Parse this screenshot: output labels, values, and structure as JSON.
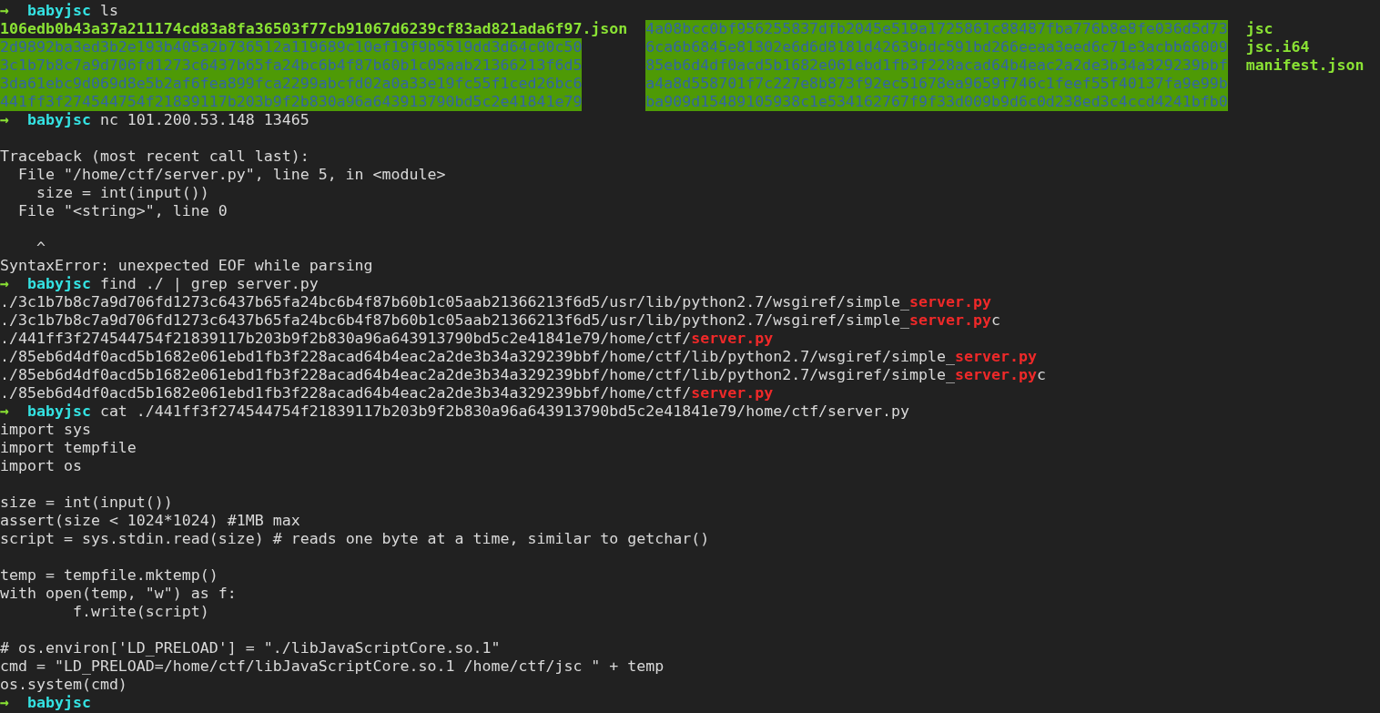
{
  "terminal": {
    "session": [
      {
        "prompt": {
          "arrow": "→",
          "directory": "babyjsc",
          "command": "ls"
        },
        "output": {
          "kind": "listing",
          "columns": [
            [
              {
                "name": "106edb0b43a37a211174cd83a8fa36503f77cb91067d6239cf83ad821ada6f97.json",
                "kind": "executable"
              },
              {
                "name": "2d9892ba3ed3b2e193b405a2b736512a119689c10ef19f9b5519dd3d64c00c50",
                "kind": "directory"
              },
              {
                "name": "3c1b7b8c7a9d706fd1273c6437b65fa24bc6b4f87b60b1c05aab21366213f6d5",
                "kind": "directory"
              },
              {
                "name": "3da61ebc9d069d8e5b2af6fea899fca2299abcfd02a0a33e19fc55f1ced26bc6",
                "kind": "directory"
              },
              {
                "name": "441ff3f274544754f21839117b203b9f2b830a96a643913790bd5c2e41841e79",
                "kind": "directory"
              }
            ],
            [
              {
                "name": "4a08bcc0bf956255837dfb2045e519a1725861c88487fba776b8e8fe036d5d73",
                "kind": "directory"
              },
              {
                "name": "6ca6b6845e81302e6d6d8181d42639bdc591bd266eeaa3eed6c71e3acbb66009",
                "kind": "directory"
              },
              {
                "name": "85eb6d4df0acd5b1682e061ebd1fb3f228acad64b4eac2a2de3b34a329239bbf",
                "kind": "directory"
              },
              {
                "name": "a4a8d558701f7c227e8b873f92ec51678ea9659f746c1feef55f40137fa9e99b",
                "kind": "directory"
              },
              {
                "name": "ba909d15489105938c1e534162767f9f33d009b9d6c0d238ed3c4ccd4241bfb0",
                "kind": "directory"
              }
            ],
            [
              {
                "name": "jsc",
                "kind": "executable"
              },
              {
                "name": "jsc.i64",
                "kind": "executable"
              },
              {
                "name": "manifest.json",
                "kind": "executable"
              }
            ]
          ]
        }
      },
      {
        "prompt": {
          "arrow": "→",
          "directory": "babyjsc",
          "command": "nc 101.200.53.148 13465"
        },
        "output": {
          "kind": "traceback",
          "lines": [
            {
              "kind": "blank"
            },
            {
              "kind": "text",
              "text": "Traceback (most recent call last):",
              "children": [
                {
                  "kind": "text",
                  "text": "File \"/home/ctf/server.py\", line 5, in <module>",
                  "children": [
                    {
                      "kind": "text",
                      "text": "size = int(input())"
                    }
                  ]
                },
                {
                  "kind": "text",
                  "text": "File \"<string>\", line 0",
                  "children": [
                    {
                      "kind": "blank"
                    },
                    {
                      "kind": "text",
                      "text": "^"
                    }
                  ]
                }
              ]
            },
            {
              "kind": "text",
              "text": "SyntaxError: unexpected EOF while parsing"
            }
          ]
        }
      },
      {
        "prompt": {
          "arrow": "→",
          "directory": "babyjsc",
          "command": "find ./ | grep server.py"
        },
        "output": {
          "kind": "matches",
          "lines": [
            {
              "kind": "text",
              "text": "./3c1b7b8c7a9d706fd1273c6437b65fa24bc6b4f87b60b1c05aab21366213f6d5/usr/lib/python2.7/wsgiref/simple_**server.py**"
            },
            {
              "kind": "text",
              "text": "./3c1b7b8c7a9d706fd1273c6437b65fa24bc6b4f87b60b1c05aab21366213f6d5/usr/lib/python2.7/wsgiref/simple_**server.py**c"
            },
            {
              "kind": "text",
              "text": "./441ff3f274544754f21839117b203b9f2b830a96a643913790bd5c2e41841e79/home/ctf/**server.py**"
            },
            {
              "kind": "text",
              "text": "./85eb6d4df0acd5b1682e061ebd1fb3f228acad64b4eac2a2de3b34a329239bbf/home/ctf/lib/python2.7/wsgiref/simple_**server.py**"
            },
            {
              "kind": "text",
              "text": "./85eb6d4df0acd5b1682e061ebd1fb3f228acad64b4eac2a2de3b34a329239bbf/home/ctf/lib/python2.7/wsgiref/simple_**server.py**c"
            },
            {
              "kind": "text",
              "text": "./85eb6d4df0acd5b1682e061ebd1fb3f228acad64b4eac2a2de3b34a329239bbf/home/ctf/**server.py**"
            }
          ]
        }
      },
      {
        "prompt": {
          "arrow": "→",
          "directory": "babyjsc",
          "command": "cat ./441ff3f274544754f21839117b203b9f2b830a96a643913790bd5c2e41841e79/home/ctf/server.py"
        },
        "output": {
          "kind": "source",
          "lines": [
            {
              "kind": "text",
              "text": "import sys"
            },
            {
              "kind": "text",
              "text": "import tempfile"
            },
            {
              "kind": "text",
              "text": "import os"
            },
            {
              "kind": "blank"
            },
            {
              "kind": "text",
              "text": "size = int(input())"
            },
            {
              "kind": "text",
              "text": "assert(size < 1024*1024) #1MB max"
            },
            {
              "kind": "text",
              "text": "script = sys.stdin.read(size) # reads one byte at a time, similar to getchar()"
            },
            {
              "kind": "blank"
            },
            {
              "kind": "text",
              "text": "temp = tempfile.mktemp()"
            },
            {
              "kind": "text",
              "text": "with open(temp, \"w\") as f:",
              "children": [
                {
                  "kind": "text",
                  "text": "f.write(script)"
                }
              ]
            },
            {
              "kind": "blank"
            },
            {
              "kind": "text",
              "text": "# os.environ['LD_PRELOAD'] = \"./libJavaScriptCore.so.1\""
            },
            {
              "kind": "text",
              "text": "cmd = \"LD_PRELOAD=/home/ctf/libJavaScriptCore.so.1 /home/ctf/jsc \" + temp"
            },
            {
              "kind": "text",
              "text": "os.system(cmd)"
            }
          ]
        }
      },
      {
        "prompt": {
          "arrow": "→",
          "directory": "babyjsc"
        }
      }
    ]
  }
}
